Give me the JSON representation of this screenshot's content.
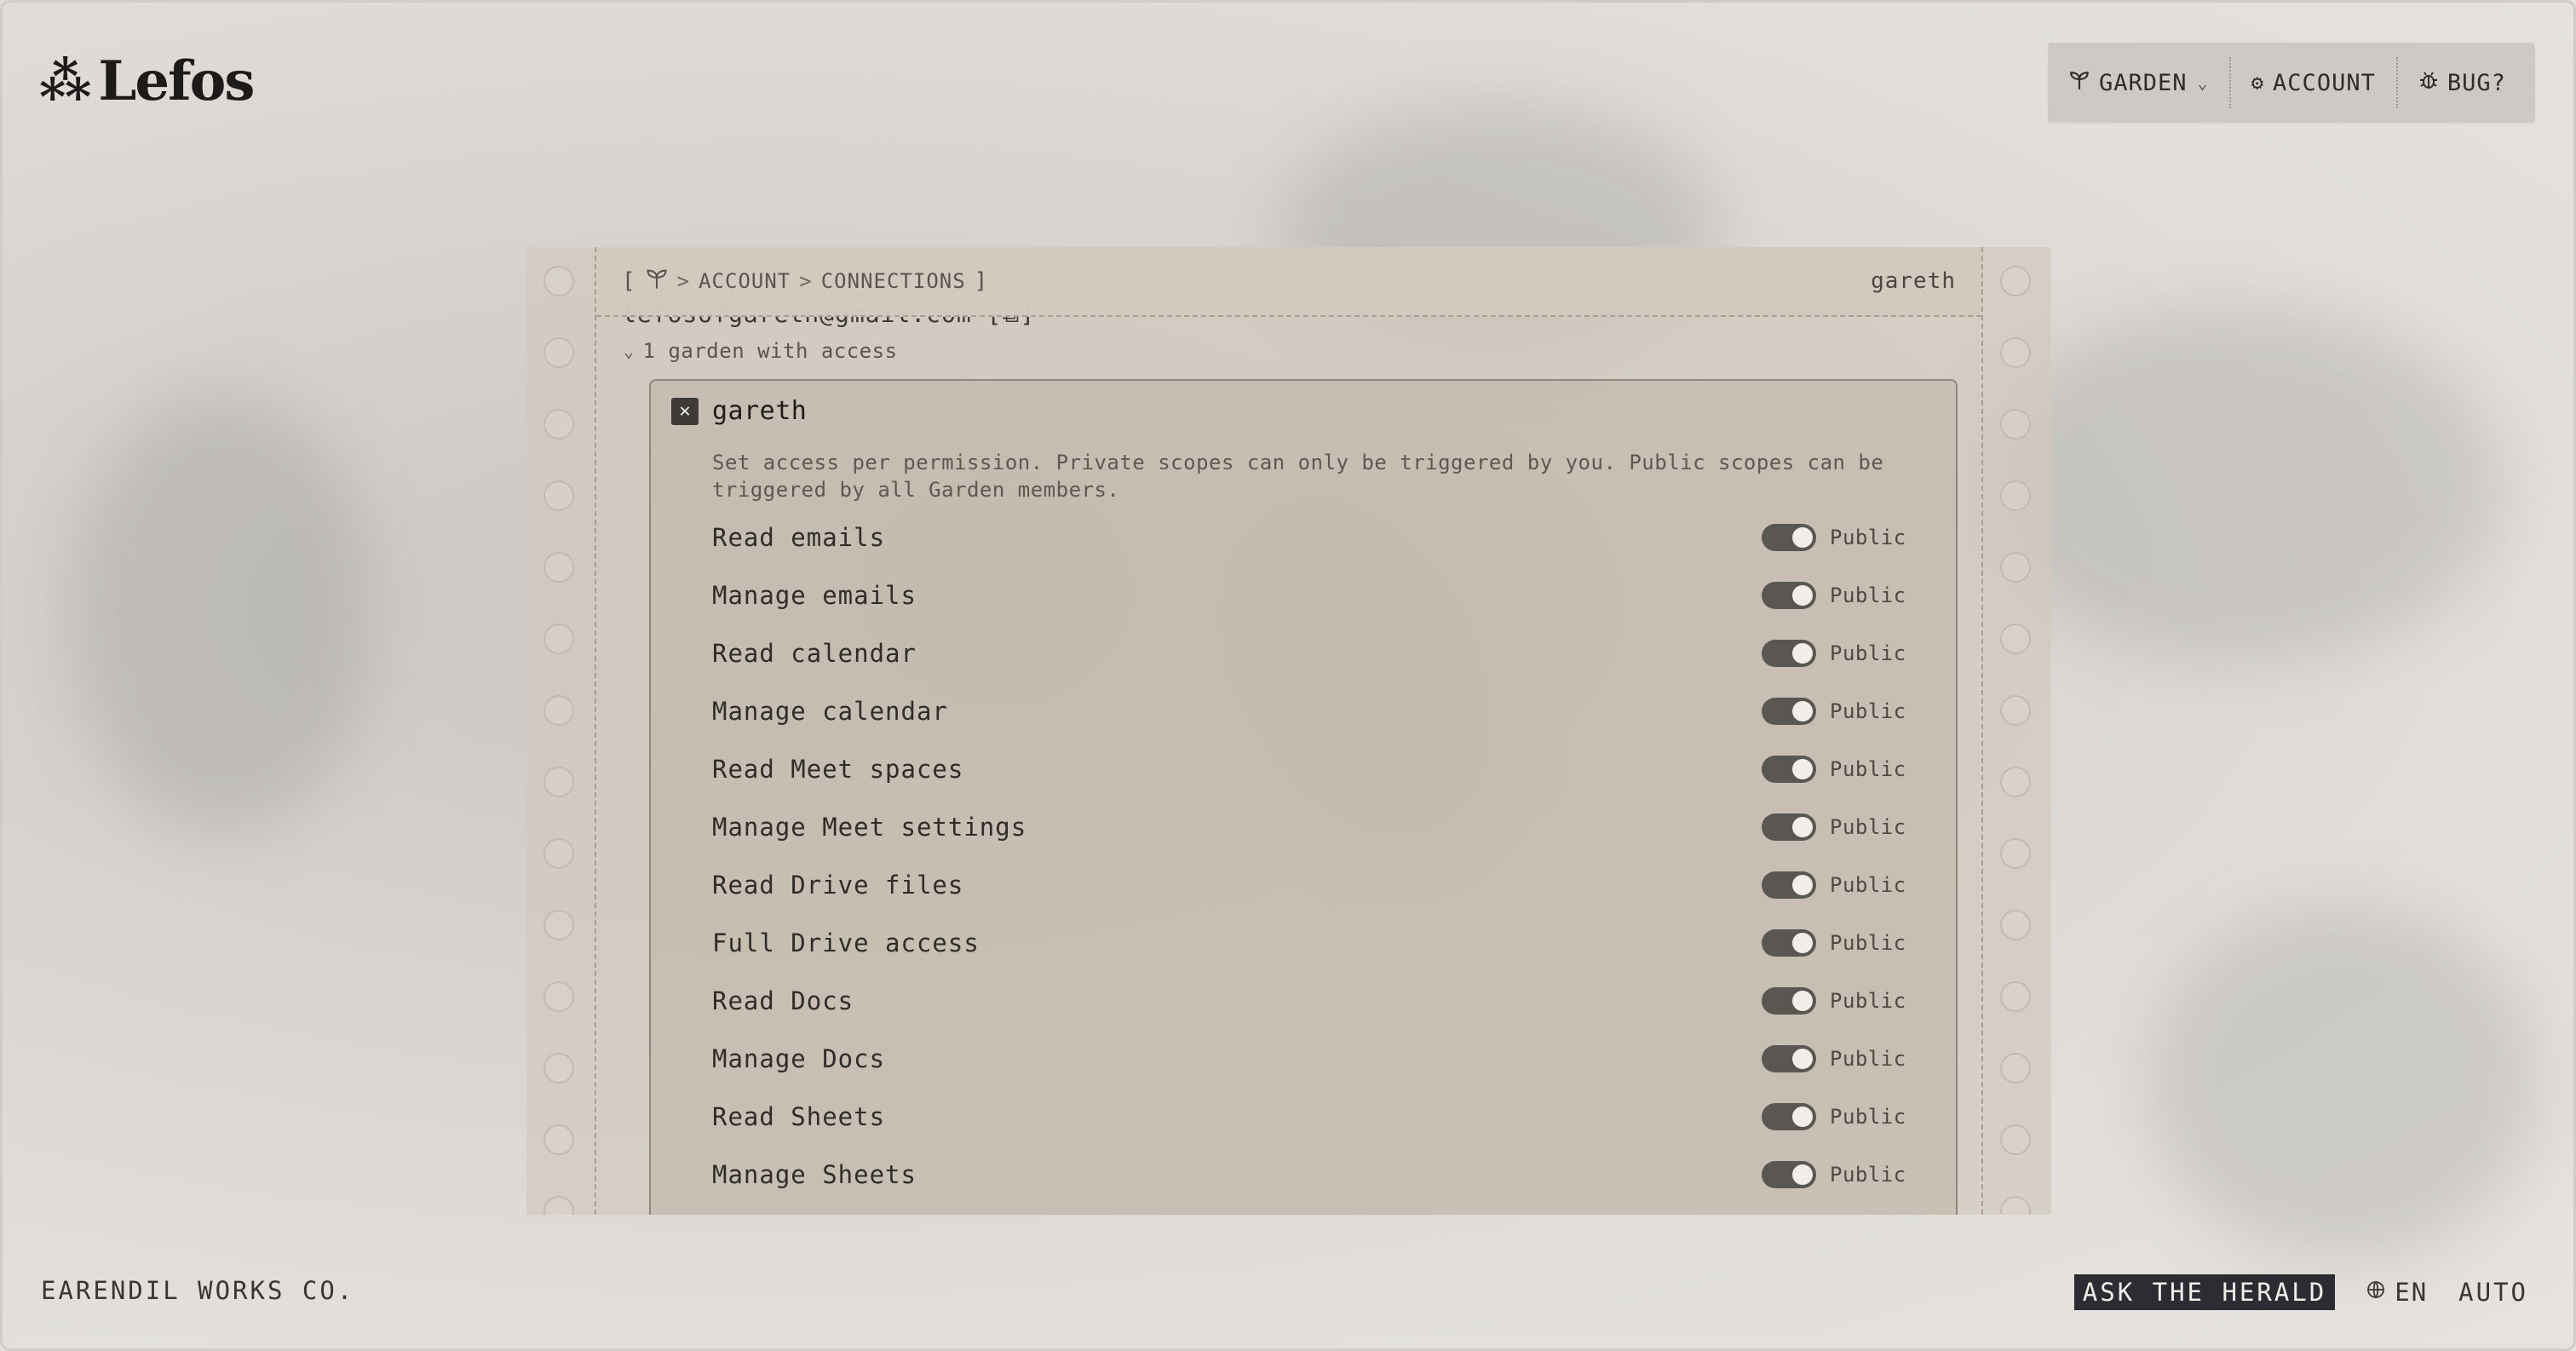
{
  "brand": {
    "logo_mark": "⁂",
    "name": "Lefos"
  },
  "nav": {
    "garden": {
      "icon": "sprout-icon",
      "label": "GARDEN"
    },
    "account": {
      "icon": "gear-icon",
      "label": "ACCOUNT"
    },
    "bug": {
      "icon": "bug-icon",
      "label": "BUG?"
    }
  },
  "breadcrumb": {
    "open": "[",
    "home_icon": "sprout-icon",
    "sep": ">",
    "items": [
      "ACCOUNT",
      "CONNECTIONS"
    ],
    "close": "]"
  },
  "current_user": "gareth",
  "connection": {
    "email": "lefosofgareth@gmail.com [⧉]",
    "access_summary": "1 garden with access",
    "garden": {
      "name": "gareth",
      "close_glyph": "✕",
      "description": "Set access per permission. Private scopes can only be triggered by you. Public scopes can be triggered by all Garden members.",
      "permissions": [
        {
          "name": "Read emails",
          "scope": "Public",
          "enabled": true
        },
        {
          "name": "Manage emails",
          "scope": "Public",
          "enabled": true
        },
        {
          "name": "Read calendar",
          "scope": "Public",
          "enabled": true
        },
        {
          "name": "Manage calendar",
          "scope": "Public",
          "enabled": true
        },
        {
          "name": "Read Meet spaces",
          "scope": "Public",
          "enabled": true
        },
        {
          "name": "Manage Meet settings",
          "scope": "Public",
          "enabled": true
        },
        {
          "name": "Read Drive files",
          "scope": "Public",
          "enabled": true
        },
        {
          "name": "Full Drive access",
          "scope": "Public",
          "enabled": true
        },
        {
          "name": "Read Docs",
          "scope": "Public",
          "enabled": true
        },
        {
          "name": "Manage Docs",
          "scope": "Public",
          "enabled": true
        },
        {
          "name": "Read Sheets",
          "scope": "Public",
          "enabled": true
        },
        {
          "name": "Manage Sheets",
          "scope": "Public",
          "enabled": true
        }
      ]
    }
  },
  "footer": {
    "company": "EARENDIL WORKS CO.",
    "herald_button": "ASK THE HERALD",
    "language": {
      "icon": "globe-icon",
      "label": "EN"
    },
    "theme": "AUTO"
  },
  "colors": {
    "background": "#e2dfdb",
    "panel": "#d3c9be",
    "toggle_on": "#5a5652",
    "herald_bg": "#2b2d33"
  }
}
